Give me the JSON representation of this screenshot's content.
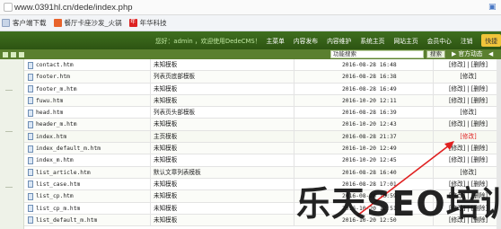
{
  "browser": {
    "url": "www.0391hl.cn/dede/index.php",
    "bookmarks": [
      {
        "label": "客户端下载",
        "icon": "doc-icon"
      },
      {
        "label": "餐厅卡座沙发_火锅",
        "icon": "sofa-icon"
      },
      {
        "label": "年华科技",
        "icon": "red-logo-icon"
      }
    ]
  },
  "header": {
    "greeting": "您好：admin ，欢迎使用DedeCMS！",
    "nav": [
      "主菜单",
      "内容发布",
      "内容维护",
      "系统主页",
      "网站主页",
      "会员中心",
      "注销"
    ],
    "highlight": "快捷"
  },
  "toolbar": {
    "search_value": "功能搜索",
    "search_button": "搜索",
    "official": "▶ 官方动态",
    "next": "◀ 在"
  },
  "files": [
    {
      "name": "contact.htm",
      "desc": "未知模板",
      "date": "2016-08-28 16:48",
      "ops": "[修改] | [删除]"
    },
    {
      "name": "footer.htm",
      "desc": "列表页底部模板",
      "date": "2016-08-28 16:38",
      "ops": "[修改]"
    },
    {
      "name": "footer_m.htm",
      "desc": "未知模板",
      "date": "2016-08-28 16:49",
      "ops": "[修改] | [删除]"
    },
    {
      "name": "fuwu.htm",
      "desc": "未知模板",
      "date": "2016-10-20 12:11",
      "ops": "[修改] | [删除]"
    },
    {
      "name": "head.htm",
      "desc": "列表页头部模板",
      "date": "2016-08-28 16:39",
      "ops": "[修改]"
    },
    {
      "name": "header_m.htm",
      "desc": "未知模板",
      "date": "2016-10-20 12:43",
      "ops": "[修改] | [删除]"
    },
    {
      "name": "index.htm",
      "desc": "主页模板",
      "date": "2016-08-28 21:37",
      "ops": "[修改]"
    },
    {
      "name": "index_default_m.htm",
      "desc": "未知模板",
      "date": "2016-10-20 12:49",
      "ops": "[修改] | [删除]"
    },
    {
      "name": "index_m.htm",
      "desc": "未知模板",
      "date": "2016-10-20 12:45",
      "ops": "[修改] | [删除]"
    },
    {
      "name": "list_article.htm",
      "desc": "默认文章列表模板",
      "date": "2016-08-28 16:40",
      "ops": "[修改]"
    },
    {
      "name": "list_case.htm",
      "desc": "未知模板",
      "date": "2016-08-28 17:01",
      "ops": "[修改] | [删除]"
    },
    {
      "name": "list_cp.htm",
      "desc": "未知模板",
      "date": "2016-08-28 16:59",
      "ops": "[修改] | [删除]"
    },
    {
      "name": "list_cp_m.htm",
      "desc": "未知模板",
      "date": "2016-10-20 12:51",
      "ops": "[修改] | [删除]"
    },
    {
      "name": "list_default_m.htm",
      "desc": "未知模板",
      "date": "2016-10-20 12:50",
      "ops": "[修改] | [删除]"
    }
  ],
  "highlight_row_index": 6,
  "watermark": "乐天SEO培训",
  "colors": {
    "nav_bg": "#2d5412",
    "highlight_red": "#e02020",
    "arrow": "#e02020"
  }
}
